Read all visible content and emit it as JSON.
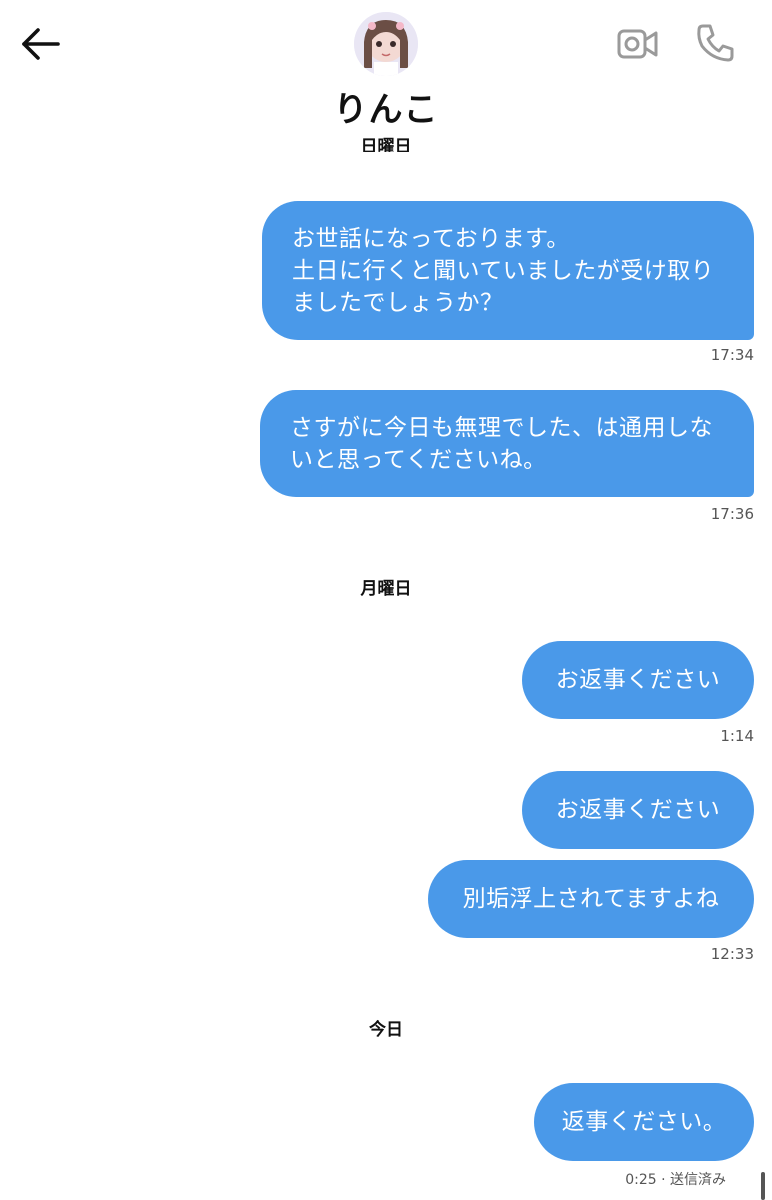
{
  "header": {
    "contact_name": "りんこ",
    "back_icon": "arrow-left-icon",
    "video_icon": "video-camera-icon",
    "call_icon": "phone-icon"
  },
  "colors": {
    "bubble": "#4a99e9",
    "bubble_text": "#ffffff",
    "icon_gray": "#9a9a9a"
  },
  "days": {
    "sunday": "日曜日",
    "monday": "月曜日",
    "today": "今日"
  },
  "messages": {
    "m1": {
      "text": "お世話になっております。\n土日に行くと聞いていましたが受け取り\nましたでしょうか？",
      "time": "17:34"
    },
    "m2": {
      "text": "さすがに今日も無理でした、は通用しな\nいと思ってくださいね。",
      "time": "17:36"
    },
    "m3": {
      "text": "お返事ください",
      "time": "1:14"
    },
    "m4": {
      "text": "お返事ください"
    },
    "m5": {
      "text": "別垢浮上されてますよね",
      "time": "12:33"
    },
    "m6": {
      "text": "返事ください。",
      "time": "0:25 · 送信済み"
    }
  }
}
